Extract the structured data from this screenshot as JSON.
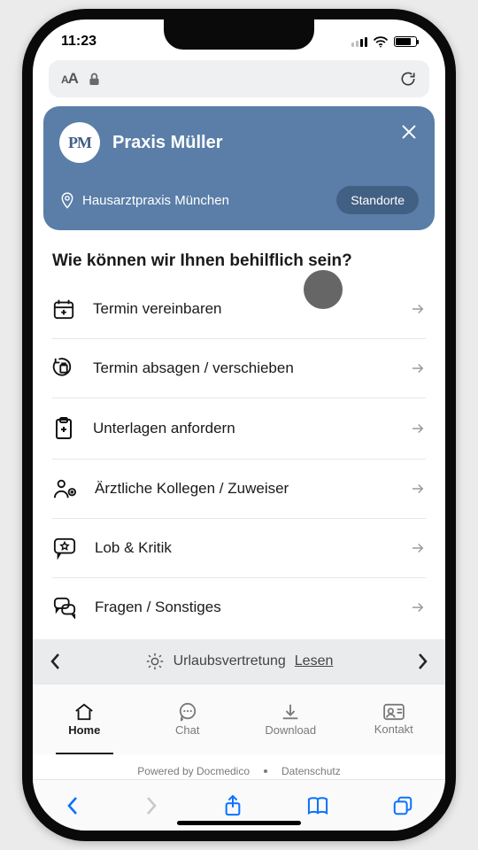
{
  "status": {
    "time": "11:23"
  },
  "hero": {
    "avatar_initials": "PM",
    "practice_name": "Praxis Müller",
    "subtitle": "Hausarztpraxis München",
    "locations_label": "Standorte"
  },
  "page_heading": "Wie können wir Ihnen behilflich sein?",
  "menu": [
    {
      "icon": "calendar-plus-icon",
      "label": "Termin vereinbaren"
    },
    {
      "icon": "calendar-cancel-icon",
      "label": "Termin absagen / verschieben"
    },
    {
      "icon": "clipboard-medical-icon",
      "label": "Unterlagen anfordern"
    },
    {
      "icon": "doctor-referral-icon",
      "label": "Ärztliche Kollegen / Zuweiser"
    },
    {
      "icon": "feedback-star-icon",
      "label": "Lob & Kritik"
    },
    {
      "icon": "chat-bubbles-icon",
      "label": "Fragen / Sonstiges"
    }
  ],
  "ticker": {
    "text": "Urlaubsvertretung",
    "link_label": "Lesen"
  },
  "tabs": [
    {
      "label": "Home",
      "icon": "home-icon",
      "active": true
    },
    {
      "label": "Chat",
      "icon": "chat-icon",
      "active": false
    },
    {
      "label": "Download",
      "icon": "download-icon",
      "active": false
    },
    {
      "label": "Kontakt",
      "icon": "contact-card-icon",
      "active": false
    }
  ],
  "footer": {
    "powered": "Powered by Docmedico",
    "privacy": "Datenschutz"
  }
}
